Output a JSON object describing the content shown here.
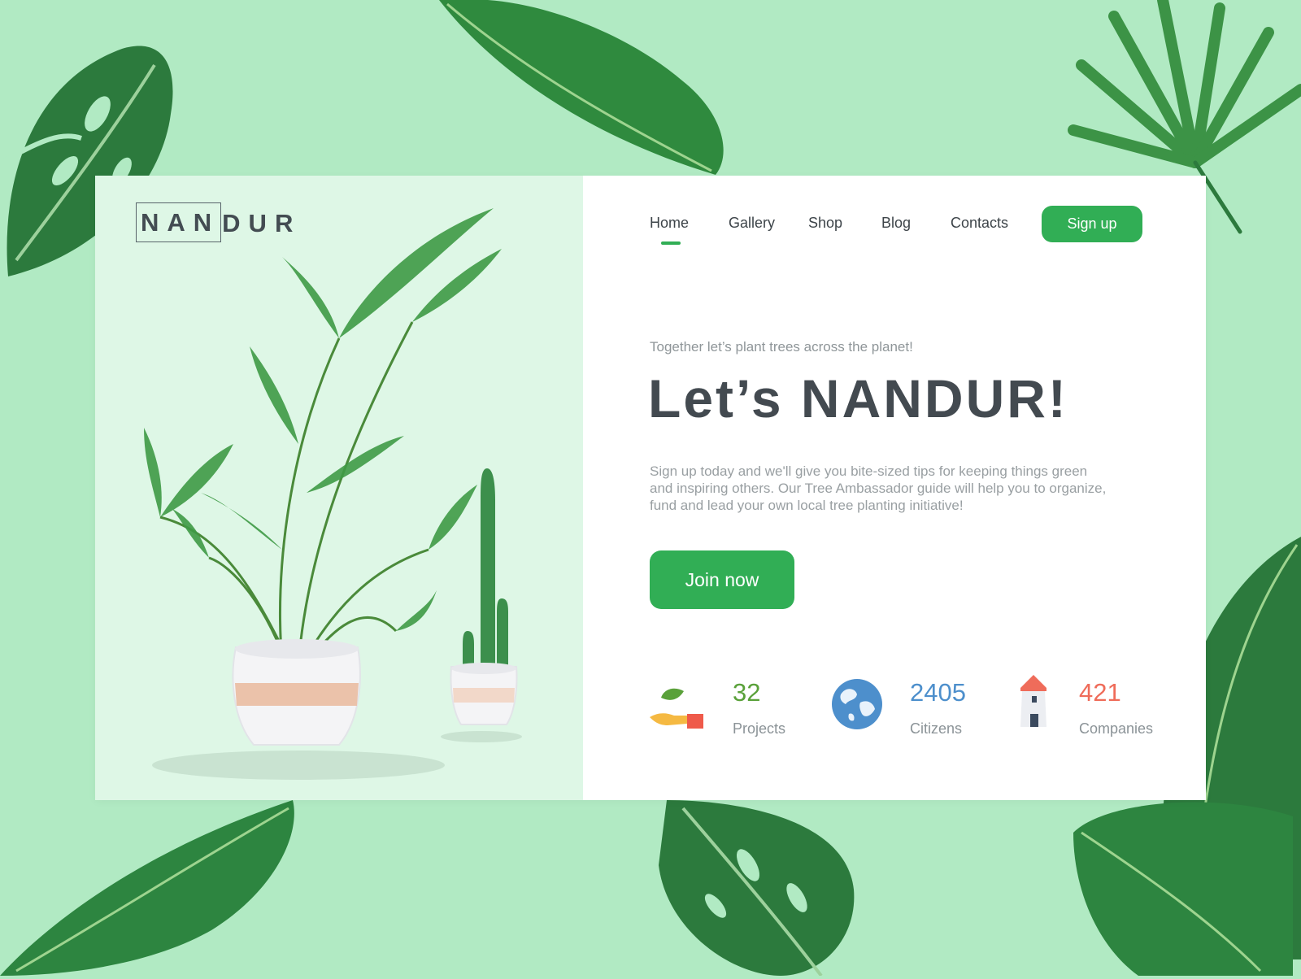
{
  "brand": {
    "logo_boxed": "NAN",
    "logo_rest": "DUR"
  },
  "nav": {
    "items": [
      {
        "label": "Home",
        "active": true
      },
      {
        "label": "Gallery",
        "active": false
      },
      {
        "label": "Shop",
        "active": false
      },
      {
        "label": "Blog",
        "active": false
      },
      {
        "label": "Contacts",
        "active": false
      }
    ],
    "signup_label": "Sign up"
  },
  "hero": {
    "tagline": "Together let’s plant trees across the planet!",
    "headline": "Let’s NANDUR!",
    "description": "Sign up today and we'll give you bite-sized tips for keeping things green and inspiring others. Our Tree Ambassador guide will help you to organize, fund and lead your own local tree planting initiative!",
    "cta_label": "Join now"
  },
  "stats": [
    {
      "icon": "hand-leaf-icon",
      "value": "32",
      "label": "Projects",
      "color": "#5aa13a"
    },
    {
      "icon": "globe-icon",
      "value": "2405",
      "label": "Citizens",
      "color": "#4d8fcc"
    },
    {
      "icon": "lighthouse-icon",
      "value": "421",
      "label": "Companies",
      "color": "#ef6c5a"
    }
  ],
  "colors": {
    "background": "#b1eac3",
    "accent": "#31ae55",
    "panel_left": "#def7e6",
    "text_dark": "#434a50",
    "text_muted": "#999fa2"
  }
}
